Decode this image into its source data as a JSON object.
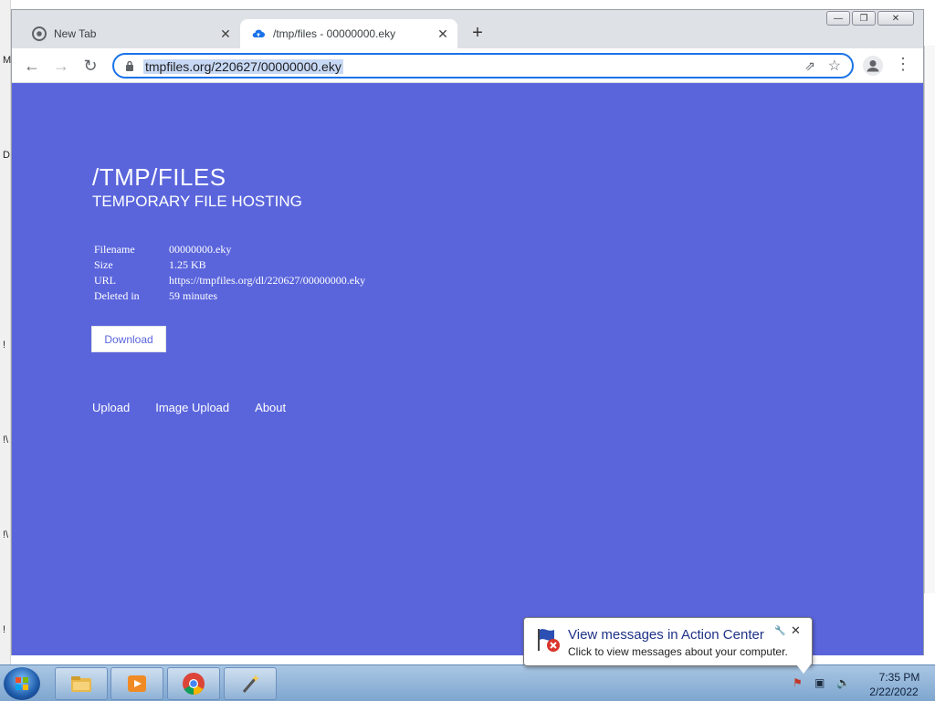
{
  "background_window": {
    "left_letters": [
      "M",
      "D",
      "!",
      "!\\",
      "!\\",
      "!"
    ]
  },
  "browser": {
    "tabs": [
      {
        "title": "New Tab",
        "icon": "chrome-icon"
      },
      {
        "title": "/tmp/files - 00000000.eky",
        "icon": "cloud-upload-icon"
      }
    ],
    "window_controls": {
      "minimize": "—",
      "restore": "❐",
      "close": "✕"
    },
    "new_tab_label": "+",
    "url": "tmpfiles.org/220627/00000000.eky"
  },
  "page": {
    "title": "/TMP/FILES",
    "subtitle": "TEMPORARY FILE HOSTING",
    "info": [
      {
        "key": "Filename",
        "value": "00000000.eky"
      },
      {
        "key": "Size",
        "value": "1.25 KB"
      },
      {
        "key": "URL",
        "value": "https://tmpfiles.org/dl/220627/00000000.eky"
      },
      {
        "key": "Deleted in",
        "value": "59 minutes"
      }
    ],
    "download_label": "Download",
    "links": [
      "Upload",
      "Image Upload",
      "About"
    ],
    "background_color": "#5a65dc"
  },
  "notification": {
    "title": "View messages in Action Center",
    "text": "Click to view messages about your computer."
  },
  "taskbar": {
    "items": [
      "windows-explorer",
      "media-player",
      "chrome",
      "wizard"
    ],
    "clock_time": "7:35 PM",
    "clock_date": "2/22/2022"
  }
}
